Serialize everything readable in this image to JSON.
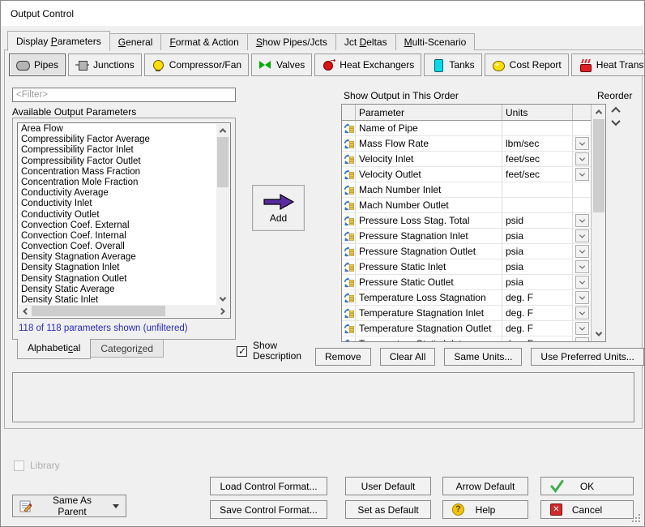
{
  "window": {
    "title": "Output Control"
  },
  "main_tabs": [
    {
      "pre": "Display ",
      "key": "P",
      "post": "arameters",
      "active": true
    },
    {
      "pre": "",
      "key": "G",
      "post": "eneral",
      "active": false
    },
    {
      "pre": "",
      "key": "F",
      "post": "ormat & Action",
      "active": false
    },
    {
      "pre": "",
      "key": "S",
      "post": "how Pipes/Jcts",
      "active": false
    },
    {
      "pre": "Jct ",
      "key": "D",
      "post": "eltas",
      "active": false
    },
    {
      "pre": "",
      "key": "M",
      "post": "ulti-Scenario",
      "active": false
    }
  ],
  "toolbar": [
    {
      "label": "Pipes",
      "icon": "pipes-icon",
      "active": true
    },
    {
      "label": "Junctions",
      "icon": "junctions-icon",
      "active": false
    },
    {
      "label": "Compressor/Fan",
      "icon": "compressor-fan-icon",
      "active": false
    },
    {
      "label": "Valves",
      "icon": "valves-icon",
      "active": false
    },
    {
      "label": "Heat Exchangers",
      "icon": "heat-exchangers-icon",
      "active": false
    },
    {
      "label": "Tanks",
      "icon": "tanks-icon",
      "active": false
    },
    {
      "label": "Cost Report",
      "icon": "cost-report-icon",
      "active": false
    },
    {
      "label": "Heat Transfer",
      "icon": "heat-transfer-icon",
      "active": false
    }
  ],
  "left_panel": {
    "filter_placeholder": "<Filter>",
    "available_label": "Available Output Parameters",
    "parameters": [
      "Area Flow",
      "Compressibility Factor Average",
      "Compressibility Factor Inlet",
      "Compressibility Factor Outlet",
      "Concentration Mass Fraction",
      "Concentration Mole Fraction",
      "Conductivity Average",
      "Conductivity Inlet",
      "Conductivity Outlet",
      "Convection Coef. External",
      "Convection Coef. Internal",
      "Convection Coef. Overall",
      "Density Stagnation Average",
      "Density Stagnation Inlet",
      "Density Stagnation Outlet",
      "Density Static Average",
      "Density Static Inlet"
    ],
    "count_text": "118 of 118 parameters shown (unfiltered)",
    "view_tabs": [
      {
        "pre": "Alphabeti",
        "key": "c",
        "post": "al",
        "active": true
      },
      {
        "pre": "Categori",
        "key": "z",
        "post": "ed",
        "active": false
      }
    ]
  },
  "add_button": {
    "label": "Add"
  },
  "show_description": {
    "label": "Show Description",
    "checked": true
  },
  "right_panel": {
    "title": "Show Output in This Order",
    "reorder_label": "Reorder",
    "columns": {
      "parameter": "Parameter",
      "units": "Units"
    },
    "rows": [
      {
        "parameter": "Name of Pipe",
        "units": ""
      },
      {
        "parameter": "Mass Flow Rate",
        "units": "lbm/sec"
      },
      {
        "parameter": "Velocity Inlet",
        "units": "feet/sec"
      },
      {
        "parameter": "Velocity Outlet",
        "units": "feet/sec"
      },
      {
        "parameter": "Mach Number Inlet",
        "units": ""
      },
      {
        "parameter": "Mach Number Outlet",
        "units": ""
      },
      {
        "parameter": "Pressure Loss Stag. Total",
        "units": "psid"
      },
      {
        "parameter": "Pressure Stagnation Inlet",
        "units": "psia"
      },
      {
        "parameter": "Pressure Stagnation Outlet",
        "units": "psia"
      },
      {
        "parameter": "Pressure Static Inlet",
        "units": "psia"
      },
      {
        "parameter": "Pressure Static Outlet",
        "units": "psia"
      },
      {
        "parameter": "Temperature Loss Stagnation",
        "units": "deg. F"
      },
      {
        "parameter": "Temperature Stagnation Inlet",
        "units": "deg. F"
      },
      {
        "parameter": "Temperature Stagnation Outlet",
        "units": "deg. F"
      },
      {
        "parameter": "Temperature Static Inlet",
        "units": "deg. F"
      }
    ],
    "actions": [
      "Remove",
      "Clear All",
      "Same Units...",
      "Use Preferred Units..."
    ]
  },
  "description_text": "",
  "footer": {
    "library_label": "Library",
    "same_as_parent": "Same As Parent",
    "buttons": {
      "load": "Load Control Format...",
      "save": "Save Control Format...",
      "user_default": "User Default",
      "set_default": "Set as Default",
      "arrow_default": "Arrow Default",
      "help": "Help",
      "ok": "OK",
      "cancel": "Cancel"
    }
  },
  "colors": {
    "dialog_bg": "#f0f0f0",
    "count_text_blue": "#2a2acc",
    "add_arrow_purple": "#5a2ca0",
    "ok_check_green": "#3fae49",
    "cancel_red": "#d22b2b",
    "help_yellow": "#f2c500",
    "valve_green": "#00ae00",
    "tank_cyan": "#00dcec",
    "compressor_yellow": "#ffdf00",
    "heat_red": "#e01010",
    "row_icon_blue": "#2f6fd0",
    "row_icon_yellow": "#ffd23e"
  }
}
